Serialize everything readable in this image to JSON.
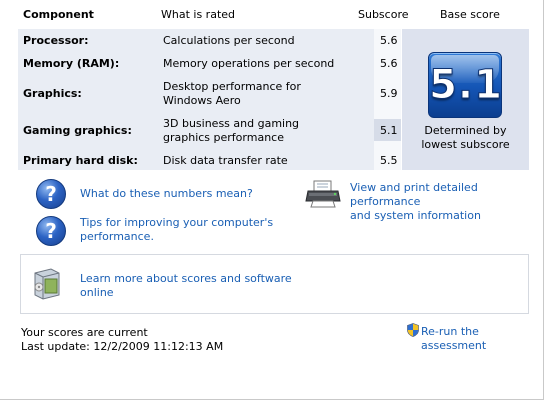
{
  "header": {
    "component": "Component",
    "what_is_rated": "What is rated",
    "subscore": "Subscore",
    "base_score": "Base score"
  },
  "rows": [
    {
      "component": "Processor:",
      "rated": [
        "Calculations per second"
      ],
      "subscore": "5.6"
    },
    {
      "component": "Memory (RAM):",
      "rated": [
        "Memory operations per second"
      ],
      "subscore": "5.6"
    },
    {
      "component": "Graphics:",
      "rated": [
        "Desktop performance for",
        "Windows Aero"
      ],
      "subscore": "5.9"
    },
    {
      "component": "Gaming graphics:",
      "rated": [
        "3D business and gaming",
        "graphics performance"
      ],
      "subscore": "5.1"
    },
    {
      "component": "Primary hard disk:",
      "rated": [
        "Disk data transfer rate"
      ],
      "subscore": "5.5"
    }
  ],
  "base": {
    "score": "5.1",
    "caption_line1": "Determined by",
    "caption_line2": "lowest subscore"
  },
  "links": {
    "numbers_meaning": "What do these numbers mean?",
    "tips_line1": "Tips for improving your computer's",
    "tips_line2": "performance.",
    "print_line1": "View and print detailed performance",
    "print_line2": "and system information",
    "learn_line1": "Learn more about scores and software",
    "learn_line2": "online",
    "rerun": "Re-run the assessment"
  },
  "status": {
    "current": "Your scores are current",
    "last_update": "Last update: 12/2/2009 11:12:13 AM"
  },
  "colors": {
    "link": "#1a5fb4",
    "table_bg": "#e9edf4",
    "badge_blue": "#1454b4"
  },
  "icons": {
    "help": "question-icon",
    "print": "printer-icon",
    "software": "software-box-icon",
    "rerun": "uac-shield-icon"
  }
}
